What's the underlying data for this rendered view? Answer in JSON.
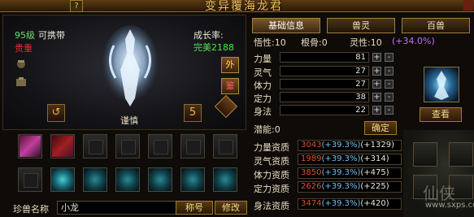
{
  "window": {
    "title": "变异覆海龙君",
    "help_label": "?"
  },
  "pet_info": {
    "level": "95级",
    "level_suffix": "可携带",
    "rarity": "贵重",
    "growth_label": "成长率:",
    "growth_value": "完美2188",
    "pet_name_display": "谨慎",
    "side_buttons": [
      "外",
      "鉴"
    ],
    "rotate_left": "↺",
    "rotate_right": "5"
  },
  "name_row": {
    "label": "珍兽名称",
    "value": "小龙",
    "title_button": "称号",
    "modify_button": "修改"
  },
  "tabs": [
    {
      "label": "基础信息",
      "active": true
    },
    {
      "label": "兽灵",
      "active": false
    },
    {
      "label": "百兽",
      "active": false
    }
  ],
  "traits": {
    "temperament": "悟性:10",
    "root_bone": "根骨:0",
    "spirit_nature": "灵性:10",
    "spirit_bonus": "(+34.0%)"
  },
  "stats": [
    {
      "label": "力量",
      "value": "81"
    },
    {
      "label": "灵气",
      "value": "27"
    },
    {
      "label": "体力",
      "value": "27"
    },
    {
      "label": "定力",
      "value": "38"
    },
    {
      "label": "身法",
      "value": "22"
    }
  ],
  "potential": {
    "label": "潜能:0",
    "confirm_button": "确定"
  },
  "aptitudes": [
    {
      "label": "力量资质",
      "base": "3043",
      "pct": "(+39.3%)",
      "bonus": "(+1329)"
    },
    {
      "label": "灵气资质",
      "base": "1989",
      "pct": "(+39.3%)",
      "bonus": "(+314)"
    },
    {
      "label": "体力资质",
      "base": "3850",
      "pct": "(+39.3%)",
      "bonus": "(+475)"
    },
    {
      "label": "定力资质",
      "base": "2626",
      "pct": "(+39.3%)",
      "bonus": "(+225)"
    },
    {
      "label": "身法资质",
      "base": "3474",
      "pct": "(+39.3%)",
      "bonus": "(+420)"
    }
  ],
  "right_panel": {
    "view_button": "查看",
    "watermark": "仙侠",
    "watermark_url": "www.sxps.com"
  },
  "colors": {
    "gold": "#f0c060",
    "green_level": "#6fe06f",
    "rarity_red": "#e03030",
    "spirit_purple": "#c070f0",
    "aptitude_base": "#e05030",
    "aptitude_pct": "#70c0f0"
  }
}
